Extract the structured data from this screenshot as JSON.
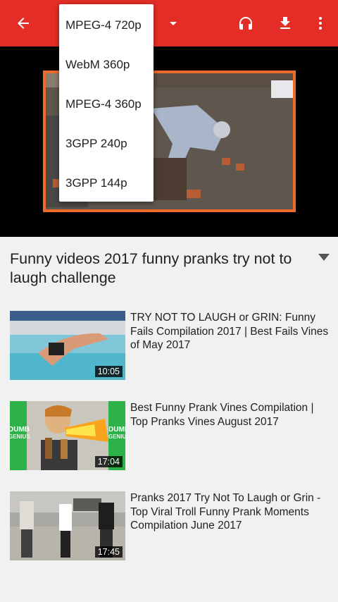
{
  "menu": {
    "items": [
      "MPEG-4 720p",
      "WebM 360p",
      "MPEG-4 360p",
      "3GPP 240p",
      "3GPP 144p"
    ]
  },
  "toolbar": {
    "icons": [
      "arrow-back-icon",
      "dropdown-arrow-icon",
      "headphones-icon",
      "download-icon",
      "more-vert-icon"
    ]
  },
  "video": {
    "title": "Funny videos 2017 funny pranks try not to laugh challenge"
  },
  "related": [
    {
      "title": "TRY NOT TO LAUGH or GRIN: Funny Fails Compilation 2017 | Best Fails Vines of May 2017",
      "duration": "10:05"
    },
    {
      "title": "Best Funny Prank Vines Compilation | Top Pranks Vines August 2017",
      "duration": "17:04",
      "thumb_text_left": "DUMB\nGENIUS",
      "thumb_text_right": "DUMB\nGENIUS"
    },
    {
      "title": "Pranks 2017 Try Not To Laugh or Grin - Top Viral Troll Funny Prank Moments Compilation June 2017",
      "duration": "17:45"
    }
  ],
  "colors": {
    "toolbar": "#e52d27",
    "frame_border": "#f06a2a",
    "background": "#f1f1f1"
  }
}
